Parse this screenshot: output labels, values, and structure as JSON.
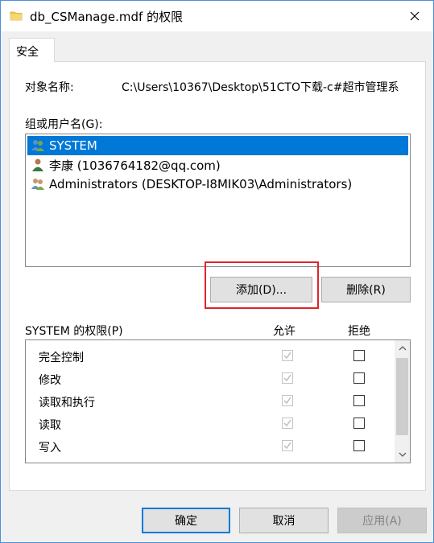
{
  "window": {
    "title": "db_CSManage.mdf 的权限"
  },
  "tabs": [
    {
      "label": "安全"
    }
  ],
  "object": {
    "label": "对象名称:",
    "value": "C:\\Users\\10367\\Desktop\\51CTO下载-c#超市管理系"
  },
  "groups": {
    "label": "组或用户名(G):",
    "items": [
      {
        "name": "SYSTEM",
        "icon": "users-group-icon",
        "selected": true
      },
      {
        "name": "李康 (1036764182@qq.com)",
        "icon": "user-icon",
        "selected": false
      },
      {
        "name": "Administrators (DESKTOP-I8MIK03\\Administrators)",
        "icon": "users-group-icon",
        "selected": false
      }
    ]
  },
  "buttons": {
    "add": "添加(D)...",
    "remove": "删除(R)",
    "ok": "确定",
    "cancel": "取消",
    "apply": "应用(A)"
  },
  "permissions": {
    "label": "SYSTEM 的权限(P)",
    "allow_header": "允许",
    "deny_header": "拒绝",
    "rows": [
      {
        "name": "完全控制",
        "allow": true,
        "deny": false
      },
      {
        "name": "修改",
        "allow": true,
        "deny": false
      },
      {
        "name": "读取和执行",
        "allow": true,
        "deny": false
      },
      {
        "name": "读取",
        "allow": true,
        "deny": false
      },
      {
        "name": "写入",
        "allow": true,
        "deny": false
      }
    ]
  },
  "colors": {
    "selection": "#0078d7",
    "highlight_annotation": "#e0242b",
    "folder": "#f2c94c"
  }
}
